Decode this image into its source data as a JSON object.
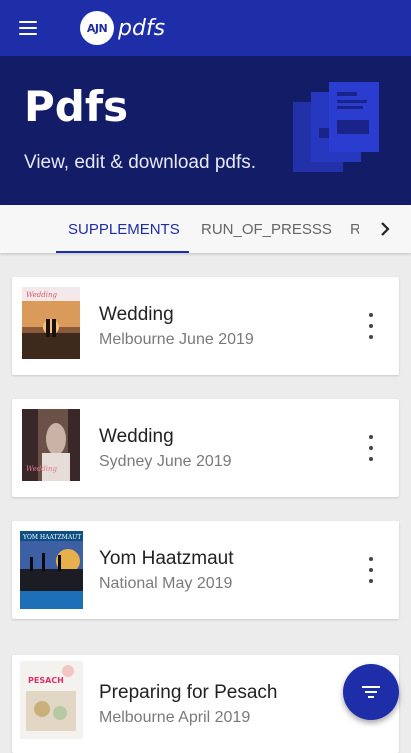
{
  "app": {
    "logo_badge": "AJN",
    "logo_text": "pdfs"
  },
  "hero": {
    "title": "Pdfs",
    "subtitle": "View, edit & download pdfs."
  },
  "tabs": [
    {
      "label": "SUPPLEMENTS",
      "active": true
    },
    {
      "label": "RUN_OF_PRESSS",
      "active": false
    },
    {
      "label": "R",
      "active": false
    }
  ],
  "items": [
    {
      "title": "Wedding",
      "subtitle": "Melbourne June 2019",
      "thumb_label": "Wedding"
    },
    {
      "title": "Wedding",
      "subtitle": "Sydney June 2019",
      "thumb_label": "Wedding"
    },
    {
      "title": "Yom Haatzmaut",
      "subtitle": "National May 2019",
      "thumb_label": "YOM HAATZMAUT"
    },
    {
      "title": "Preparing for Pesach",
      "subtitle": "Melbourne April 2019",
      "thumb_label": "PESACH"
    }
  ],
  "icons": {
    "menu": "hamburger-menu-icon",
    "next": "chevron-right-icon",
    "more": "more-vertical-icon",
    "filter": "filter-icon"
  },
  "colors": {
    "primary": "#1e2ea8",
    "hero_bg": "#131c66",
    "page_bg": "#ececec"
  }
}
